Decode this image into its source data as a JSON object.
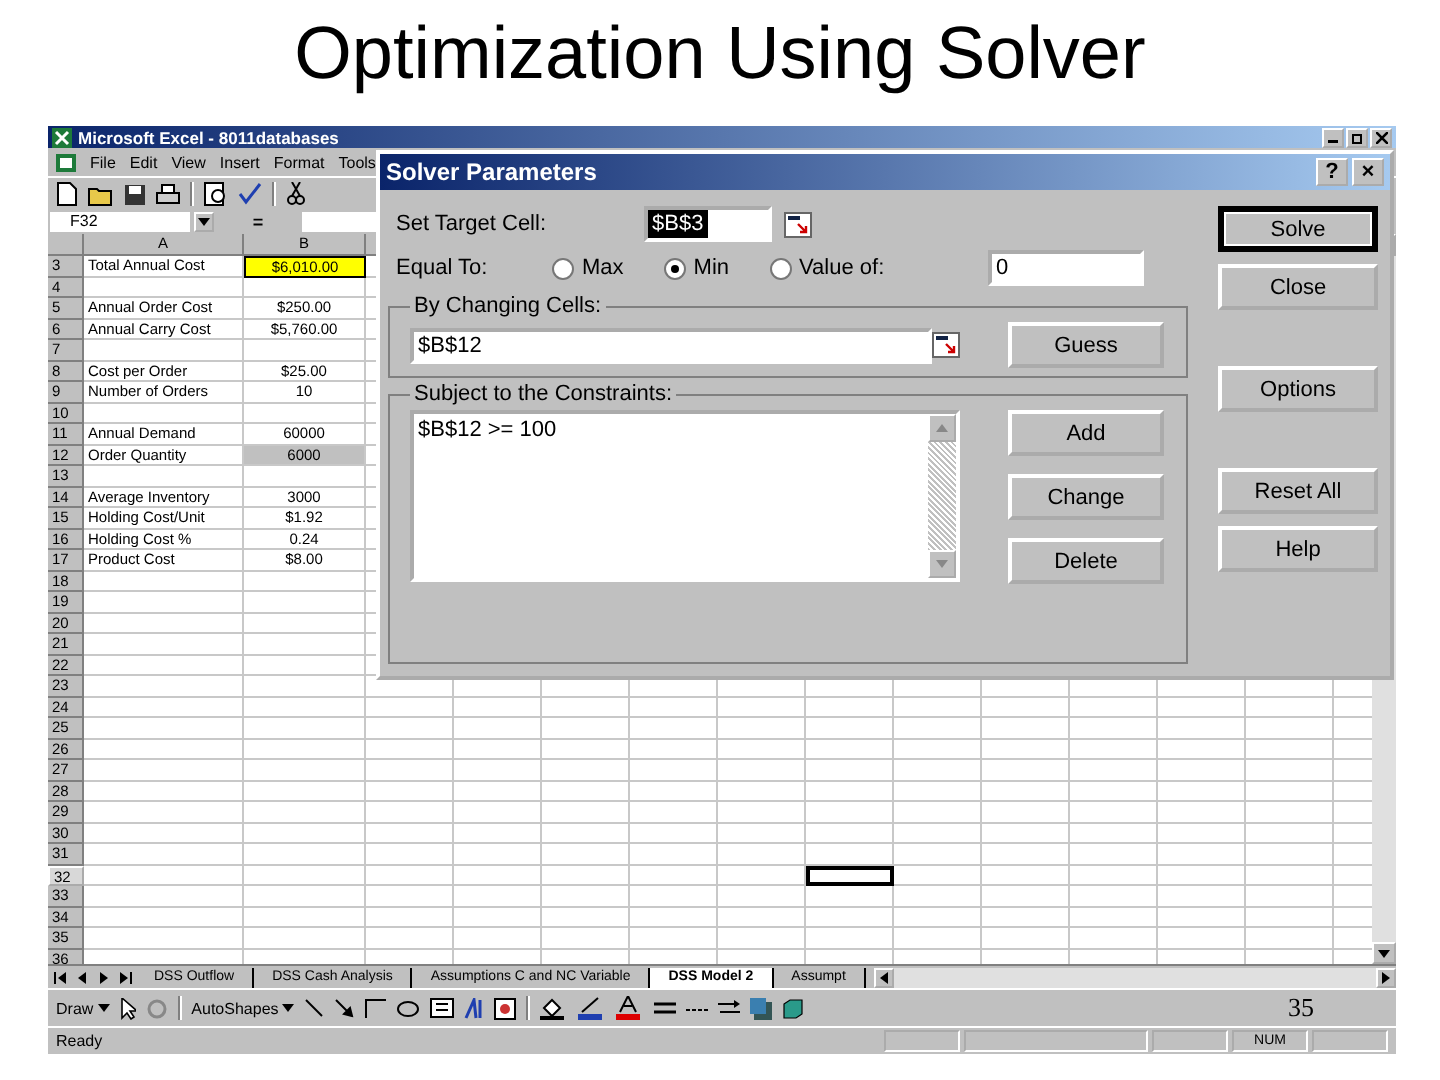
{
  "slide": {
    "title": "Optimization Using Solver",
    "page_number": "35"
  },
  "excel": {
    "title": "Microsoft Excel - 8011databases",
    "menu": [
      "File",
      "Edit",
      "View",
      "Insert",
      "Format",
      "Tools"
    ],
    "name_box": "F32",
    "formula_sign": "=",
    "columns": [
      {
        "label": "A"
      },
      {
        "label": "B"
      }
    ],
    "rows": [
      {
        "number": "3",
        "label": "Total Annual Cost",
        "value": "$6,010.00",
        "kind": "target",
        "selected": false
      },
      {
        "number": "4",
        "selected": false
      },
      {
        "number": "5",
        "label": "Annual Order Cost",
        "value": "$250.00",
        "kind": "plain",
        "selected": false
      },
      {
        "number": "6",
        "label": "Annual Carry Cost",
        "value": "$5,760.00",
        "kind": "plain",
        "selected": false
      },
      {
        "number": "7",
        "selected": false
      },
      {
        "number": "8",
        "label": "Cost per Order",
        "value": "$25.00",
        "kind": "plain",
        "selected": false
      },
      {
        "number": "9",
        "label": "Number of Orders",
        "value": "10",
        "kind": "plain",
        "selected": false
      },
      {
        "number": "10",
        "selected": false
      },
      {
        "number": "11",
        "label": "Annual Demand",
        "value": "60000",
        "kind": "plain",
        "selected": false
      },
      {
        "number": "12",
        "label": "Order Quantity",
        "value": "6000",
        "kind": "shaded",
        "selected": false
      },
      {
        "number": "13",
        "selected": false
      },
      {
        "number": "14",
        "label": "Average Inventory",
        "value": "3000",
        "kind": "plain",
        "selected": false
      },
      {
        "number": "15",
        "label": "Holding Cost/Unit",
        "value": "$1.92",
        "kind": "plain",
        "selected": false
      },
      {
        "number": "16",
        "label": "Holding Cost %",
        "value": "0.24",
        "kind": "plain",
        "selected": false
      },
      {
        "number": "17",
        "label": "Product Cost",
        "value": "$8.00",
        "kind": "plain",
        "selected": false
      },
      {
        "number": "18",
        "selected": false
      },
      {
        "number": "19",
        "selected": false
      },
      {
        "number": "20",
        "selected": false
      },
      {
        "number": "21",
        "selected": false
      },
      {
        "number": "22",
        "selected": false
      },
      {
        "number": "23",
        "selected": false
      },
      {
        "number": "24",
        "selected": false
      },
      {
        "number": "25",
        "selected": false
      },
      {
        "number": "26",
        "selected": false
      },
      {
        "number": "27",
        "selected": false
      },
      {
        "number": "28",
        "selected": false
      },
      {
        "number": "29",
        "selected": false
      },
      {
        "number": "30",
        "selected": false
      },
      {
        "number": "31",
        "selected": false
      },
      {
        "number": "32",
        "selected": true
      },
      {
        "number": "33",
        "selected": false
      },
      {
        "number": "34",
        "selected": false
      },
      {
        "number": "35",
        "selected": false
      },
      {
        "number": "36",
        "selected": false
      }
    ],
    "sheet_tabs": [
      {
        "label": "DSS Outflow",
        "selected": false
      },
      {
        "label": "DSS Cash Analysis",
        "selected": false
      },
      {
        "label": "Assumptions C and NC Variable",
        "selected": false
      },
      {
        "label": "DSS Model 2",
        "selected": true
      },
      {
        "label": "Assumpt",
        "selected": false
      }
    ],
    "draw_menu": "Draw",
    "autoshapes_menu": "AutoShapes",
    "status": "Ready",
    "num_indicator": "NUM"
  },
  "dialog": {
    "title": "Solver Parameters",
    "help": "?",
    "close": "×",
    "target_label": "Set Target Cell:",
    "target_value": "$B$3",
    "equal_label": "Equal To:",
    "options": [
      {
        "label": "Max",
        "selected": false
      },
      {
        "label": "Min",
        "selected": true
      },
      {
        "label": "Value of:",
        "selected": false
      }
    ],
    "value_of": "0",
    "changing_label": "By Changing Cells:",
    "changing_value": "$B$12",
    "guess": "Guess",
    "constraints_label": "Subject to the Constraints:",
    "constraints": [
      "$B$12 >= 100"
    ],
    "constraint_buttons": [
      "Add",
      "Change",
      "Delete"
    ],
    "side_buttons": [
      {
        "label": "Solve",
        "kind": "default"
      },
      {
        "label": "Close",
        "kind": "normal"
      },
      {
        "label": "Options",
        "kind": "normal"
      },
      {
        "label": "Reset All",
        "kind": "normal"
      },
      {
        "label": "Help",
        "kind": "normal"
      }
    ]
  }
}
